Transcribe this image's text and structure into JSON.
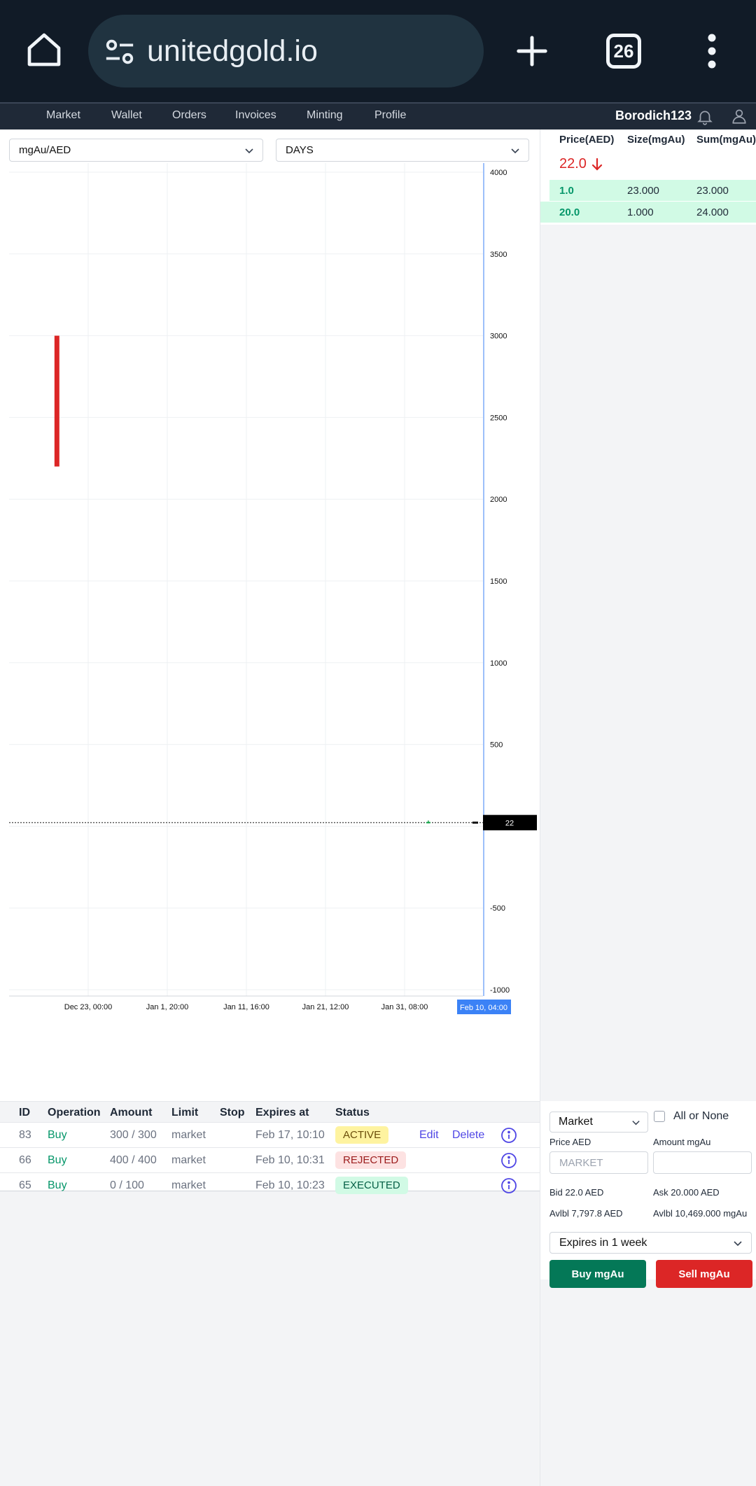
{
  "browser": {
    "url": "unitedgold.io",
    "tab_count": "26"
  },
  "nav": {
    "items": [
      "Market",
      "Wallet",
      "Orders",
      "Invoices",
      "Minting",
      "Profile"
    ],
    "username": "Borodich123"
  },
  "chart_controls": {
    "pair": "mgAu/AED",
    "interval": "DAYS"
  },
  "chart_data": {
    "type": "candlestick",
    "y_ticks": [
      4000,
      3500,
      3000,
      2500,
      2000,
      1500,
      1000,
      500,
      -500,
      -1000
    ],
    "ylim": [
      -1000,
      4000
    ],
    "x_ticks": [
      "Dec 23, 00:00",
      "Jan 1, 20:00",
      "Jan 11, 16:00",
      "Jan 21, 12:00",
      "Jan 31, 08:00"
    ],
    "current_x_label": "Feb 10, 04:00",
    "last_price_label": "22",
    "last_price": 22,
    "candles": [
      {
        "index": -0.4,
        "high": 3000,
        "low": 2200,
        "direction": "down"
      },
      {
        "index": 4.3,
        "high": 22,
        "low": 22,
        "direction": "up"
      }
    ],
    "grid": true,
    "colors": {
      "down": "#dc2626",
      "up": "#16a34a",
      "crosshair": "#3b82f6"
    }
  },
  "order_book": {
    "headers": [
      "Price(AED)",
      "Size(mgAu)",
      "Sum(mgAu)"
    ],
    "last_price": "22.0",
    "rows": [
      {
        "price": "1.0",
        "size": "23.000",
        "sum": "23.000"
      },
      {
        "price": "20.0",
        "size": "1.000",
        "sum": "24.000"
      }
    ]
  },
  "orders": {
    "headers": [
      "ID",
      "Operation",
      "Amount",
      "Limit",
      "Stop",
      "Expires at",
      "Status"
    ],
    "rows": [
      {
        "id": "83",
        "operation": "Buy",
        "amount": "300 / 300",
        "limit": "market",
        "stop": "",
        "expires": "Feb 17, 10:10",
        "status": "ACTIVE",
        "status_kind": "active",
        "edit": "Edit",
        "delete": "Delete"
      },
      {
        "id": "66",
        "operation": "Buy",
        "amount": "400 / 400",
        "limit": "market",
        "stop": "",
        "expires": "Feb 10, 10:31",
        "status": "REJECTED",
        "status_kind": "rejected",
        "edit": "",
        "delete": ""
      },
      {
        "id": "65",
        "operation": "Buy",
        "amount": "0 / 100",
        "limit": "market",
        "stop": "",
        "expires": "Feb 10, 10:23",
        "status": "EXECUTED",
        "status_kind": "executed",
        "edit": "",
        "delete": ""
      }
    ]
  },
  "trade": {
    "order_type": "Market",
    "all_or_none": "All or None",
    "price_label": "Price AED",
    "price_placeholder": "MARKET",
    "amount_label": "Amount mgAu",
    "amount_value": "",
    "bid": "Bid 22.0 AED",
    "ask": "Ask 20.000 AED",
    "avail_aed": "Avlbl 7,797.8 AED",
    "avail_mgau": "Avlbl 10,469.000 mgAu",
    "expires": "Expires in 1 week",
    "buy_label": "Buy mgAu",
    "sell_label": "Sell mgAu"
  }
}
